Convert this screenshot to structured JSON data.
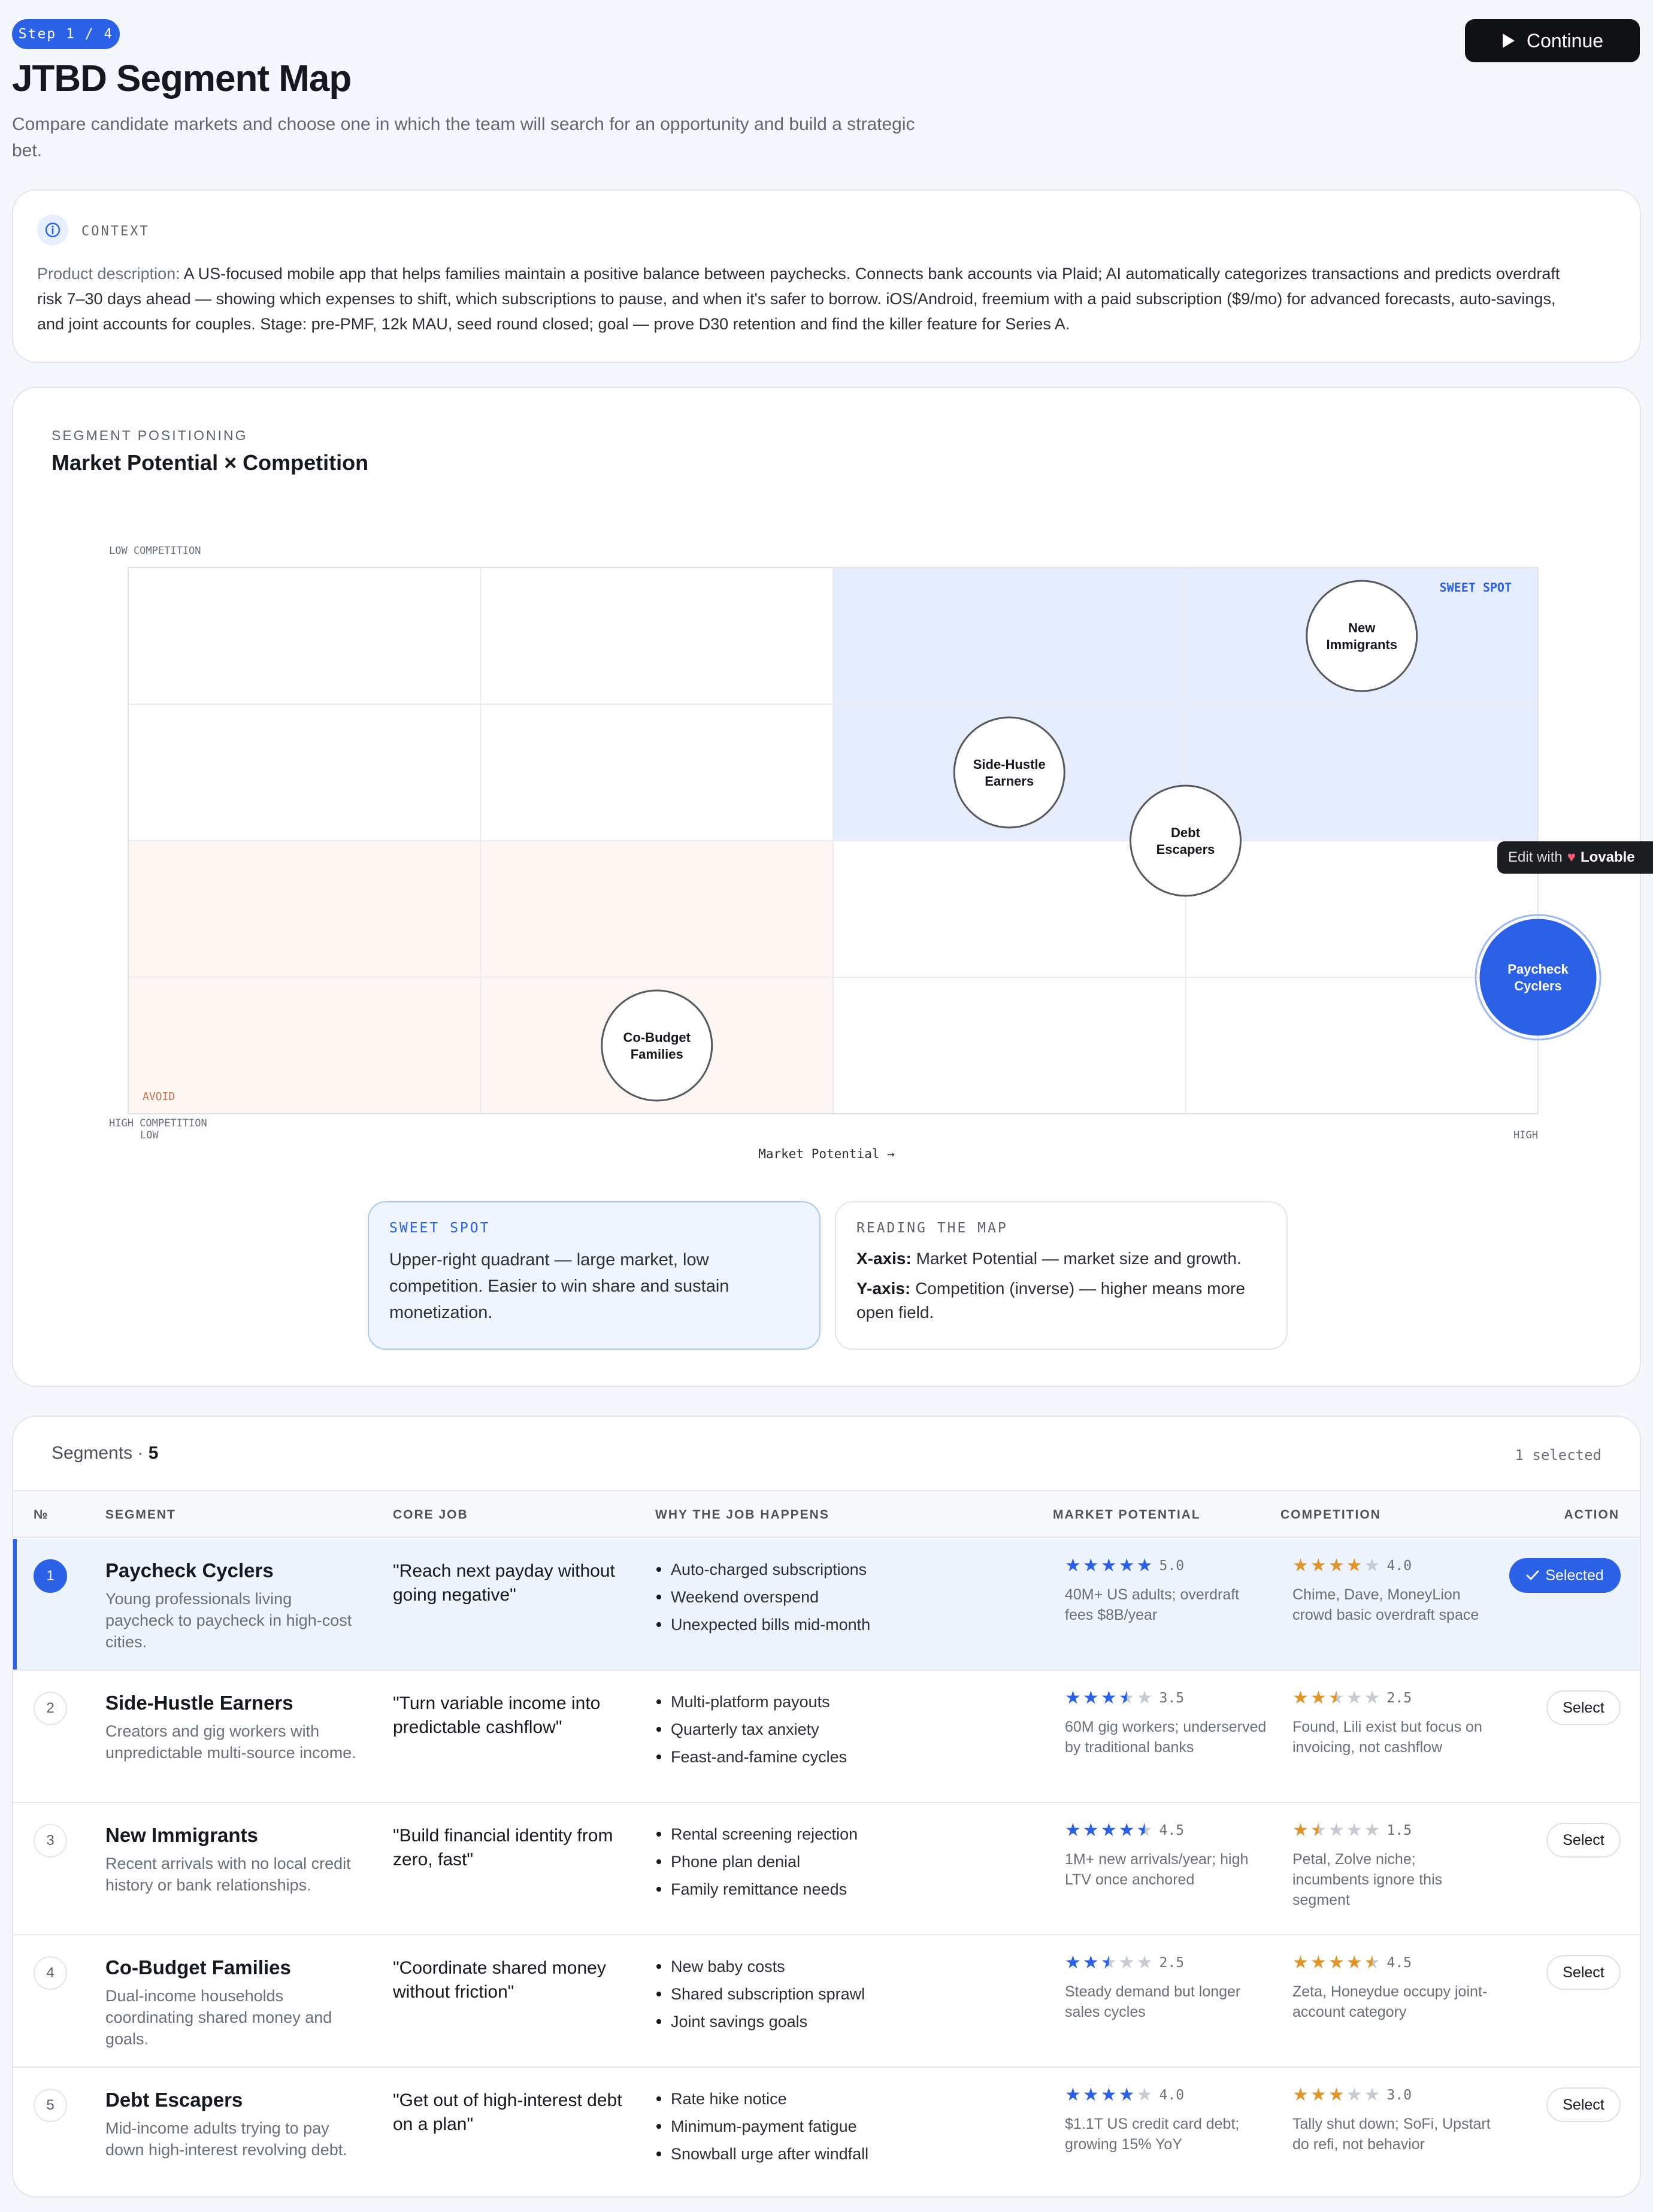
{
  "header": {
    "step": "Step 1 / 4",
    "title": "JTBD Segment Map",
    "subtitle": "Compare candidate markets and choose one in which the team will search for an opportunity and build a strategic bet.",
    "continue_label": "Continue"
  },
  "context": {
    "label": "CONTEXT",
    "prefix": "Product description:",
    "text": "A US-focused mobile app that helps families maintain a positive balance between paychecks. Connects bank accounts via Plaid; AI automatically categorizes transactions and predicts overdraft risk 7–30 days ahead — showing which expenses to shift, which subscriptions to pause, and when it's safer to borrow. iOS/Android, freemium with a paid subscription ($9/mo) for advanced forecasts, auto-savings, and joint accounts for couples. Stage: pre-PMF, 12k MAU, seed round closed; goal — prove D30 retention and find the killer feature for Series A."
  },
  "map": {
    "label": "SEGMENT POSITIONING",
    "title": "Market Potential × Competition"
  },
  "chart_data": {
    "type": "scatter",
    "title": "Market Potential × Competition",
    "xlabel": "Market Potential →",
    "x_ticks": [
      "LOW",
      "HIGH"
    ],
    "y_ticks": [
      "LOW COMPETITION",
      "HIGH COMPETITION"
    ],
    "quadrant_labels": [
      "SWEET SPOT",
      "AVOID"
    ],
    "xlim": [
      1,
      5
    ],
    "ylim": [
      1,
      5
    ],
    "selected": "Paycheck Cyclers",
    "points": [
      {
        "label": "Paycheck Cyclers",
        "x": 5.0,
        "y": 2.0
      },
      {
        "label": "Side-Hustle Earners",
        "x": 3.5,
        "y": 3.5
      },
      {
        "label": "New Immigrants",
        "x": 4.5,
        "y": 4.5
      },
      {
        "label": "Co-Budget Families",
        "x": 2.5,
        "y": 1.5
      },
      {
        "label": "Debt Escapers",
        "x": 4.0,
        "y": 3.0
      }
    ]
  },
  "info": {
    "sweet_label": "SWEET SPOT",
    "sweet_text": "Upper-right quadrant — large market, low competition. Easier to win share and sustain monetization.",
    "read_label": "READING THE MAP",
    "x_key": "X-axis:",
    "x_text": "Market Potential — market size and growth.",
    "y_key": "Y-axis:",
    "y_text": "Competition (inverse) — higher means more open field."
  },
  "lovable": {
    "prefix": "Edit with",
    "brand": "Lovable"
  },
  "segments": {
    "heading": "Segments",
    "count": "5",
    "selected_text": "1 selected",
    "columns": [
      "№",
      "SEGMENT",
      "CORE JOB",
      "WHY THE JOB HAPPENS",
      "MARKET POTENTIAL",
      "COMPETITION",
      "ACTION"
    ],
    "rows": [
      {
        "num": "1",
        "name": "Paycheck Cyclers",
        "desc": "Young professionals living paycheck to paycheck in high-cost cities.",
        "job": "\"Reach next payday without going negative\"",
        "why": [
          "Auto-charged subscriptions",
          "Weekend overspend",
          "Unexpected bills mid-month"
        ],
        "mp": 5.0,
        "mp_score": "5.0",
        "mp_note": "40M+ US adults; overdraft fees $8B/year",
        "comp": 4.0,
        "comp_score": "4.0",
        "comp_note": "Chime, Dave, MoneyLion crowd basic overdraft space",
        "action": "Selected",
        "selected": true
      },
      {
        "num": "2",
        "name": "Side-Hustle Earners",
        "desc": "Creators and gig workers with unpredictable multi-source income.",
        "job": "\"Turn variable income into predictable cashflow\"",
        "why": [
          "Multi-platform payouts",
          "Quarterly tax anxiety",
          "Feast-and-famine cycles"
        ],
        "mp": 3.5,
        "mp_score": "3.5",
        "mp_note": "60M gig workers; underserved by traditional banks",
        "comp": 2.5,
        "comp_score": "2.5",
        "comp_note": "Found, Lili exist but focus on invoicing, not cashflow",
        "action": "Select",
        "selected": false
      },
      {
        "num": "3",
        "name": "New Immigrants",
        "desc": "Recent arrivals with no local credit history or bank relationships.",
        "job": "\"Build financial identity from zero, fast\"",
        "why": [
          "Rental screening rejection",
          "Phone plan denial",
          "Family remittance needs"
        ],
        "mp": 4.5,
        "mp_score": "4.5",
        "mp_note": "1M+ new arrivals/year; high LTV once anchored",
        "comp": 1.5,
        "comp_score": "1.5",
        "comp_note": "Petal, Zolve niche; incumbents ignore this segment",
        "action": "Select",
        "selected": false
      },
      {
        "num": "4",
        "name": "Co-Budget Families",
        "desc": "Dual-income households coordinating shared money and goals.",
        "job": "\"Coordinate shared money without friction\"",
        "why": [
          "New baby costs",
          "Shared subscription sprawl",
          "Joint savings goals"
        ],
        "mp": 2.5,
        "mp_score": "2.5",
        "mp_note": "Steady demand but longer sales cycles",
        "comp": 4.5,
        "comp_score": "4.5",
        "comp_note": "Zeta, Honeydue occupy joint-account category",
        "action": "Select",
        "selected": false
      },
      {
        "num": "5",
        "name": "Debt Escapers",
        "desc": "Mid-income adults trying to pay down high-interest revolving debt.",
        "job": "\"Get out of high-interest debt on a plan\"",
        "why": [
          "Rate hike notice",
          "Minimum-payment fatigue",
          "Snowball urge after windfall"
        ],
        "mp": 4.0,
        "mp_score": "4.0",
        "mp_note": "$1.1T US credit card debt; growing 15% YoY",
        "comp": 3.0,
        "comp_score": "3.0",
        "comp_note": "Tally shut down; SoFi, Upstart do refi, not behavior",
        "action": "Select",
        "selected": false
      }
    ]
  },
  "colors": {
    "accent": "#2b61e6",
    "sweet_fill": "#e6edfd",
    "avoid_fill": "#fdf6f3",
    "star_orange": "#e0952a",
    "dark": "#101114"
  }
}
